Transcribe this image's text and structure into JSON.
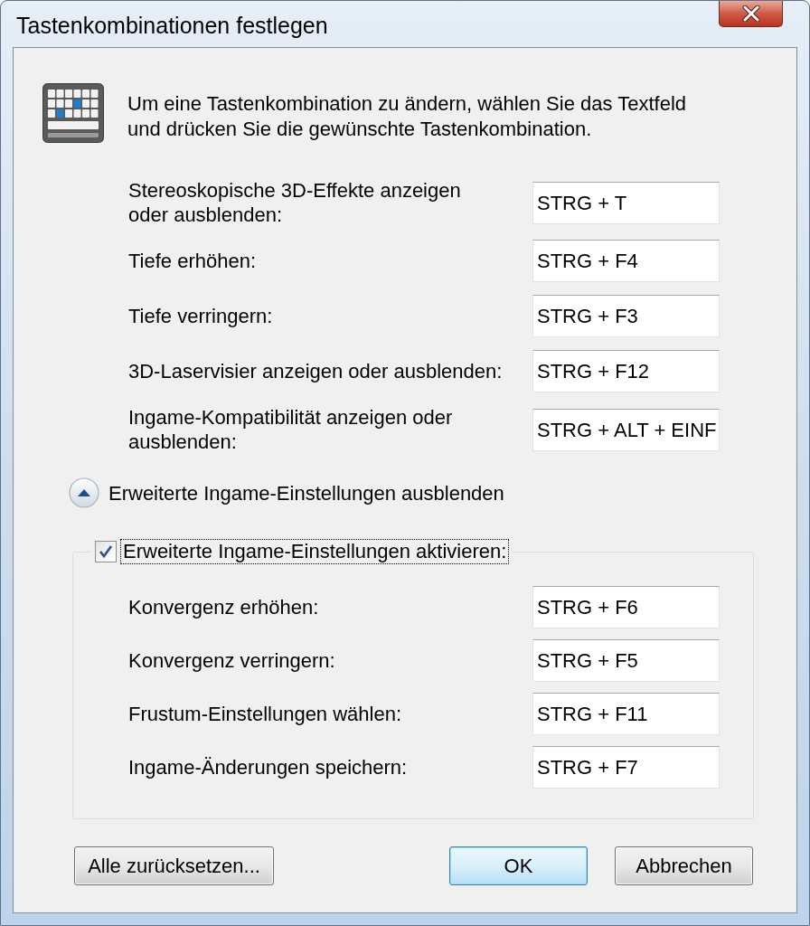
{
  "window": {
    "title": "Tastenkombinationen festlegen"
  },
  "intro": "Um eine Tastenkombination zu ändern, wählen Sie das Textfeld und drücken Sie die gewünschte Tastenkombination.",
  "shortcuts": [
    {
      "label": "Stereoskopische 3D-Effekte anzeigen oder ausblenden:",
      "value": "STRG + T"
    },
    {
      "label": "Tiefe erhöhen:",
      "value": "STRG + F4"
    },
    {
      "label": "Tiefe verringern:",
      "value": "STRG + F3"
    },
    {
      "label": "3D-Laservisier anzeigen oder ausblenden:",
      "value": "STRG + F12"
    },
    {
      "label": "Ingame-Kompatibilität anzeigen oder ausblenden:",
      "value": "STRG + ALT + EINF"
    }
  ],
  "expander": {
    "label": "Erweiterte Ingame-Einstellungen ausblenden",
    "expanded": true
  },
  "ingame_group": {
    "checkbox": {
      "label": "Erweiterte Ingame-Einstellungen aktivieren:",
      "checked": true,
      "focused": true
    },
    "shortcuts": [
      {
        "label": "Konvergenz erhöhen:",
        "value": "STRG + F6"
      },
      {
        "label": "Konvergenz verringern:",
        "value": "STRG + F5"
      },
      {
        "label": "Frustum-Einstellungen wählen:",
        "value": "STRG + F11"
      },
      {
        "label": "Ingame-Änderungen speichern:",
        "value": "STRG + F7"
      }
    ]
  },
  "buttons": [
    {
      "label": "Alle zurücksetzen...",
      "default": false
    },
    {
      "label": "OK",
      "default": true
    },
    {
      "label": "Abbrechen",
      "default": false
    }
  ]
}
